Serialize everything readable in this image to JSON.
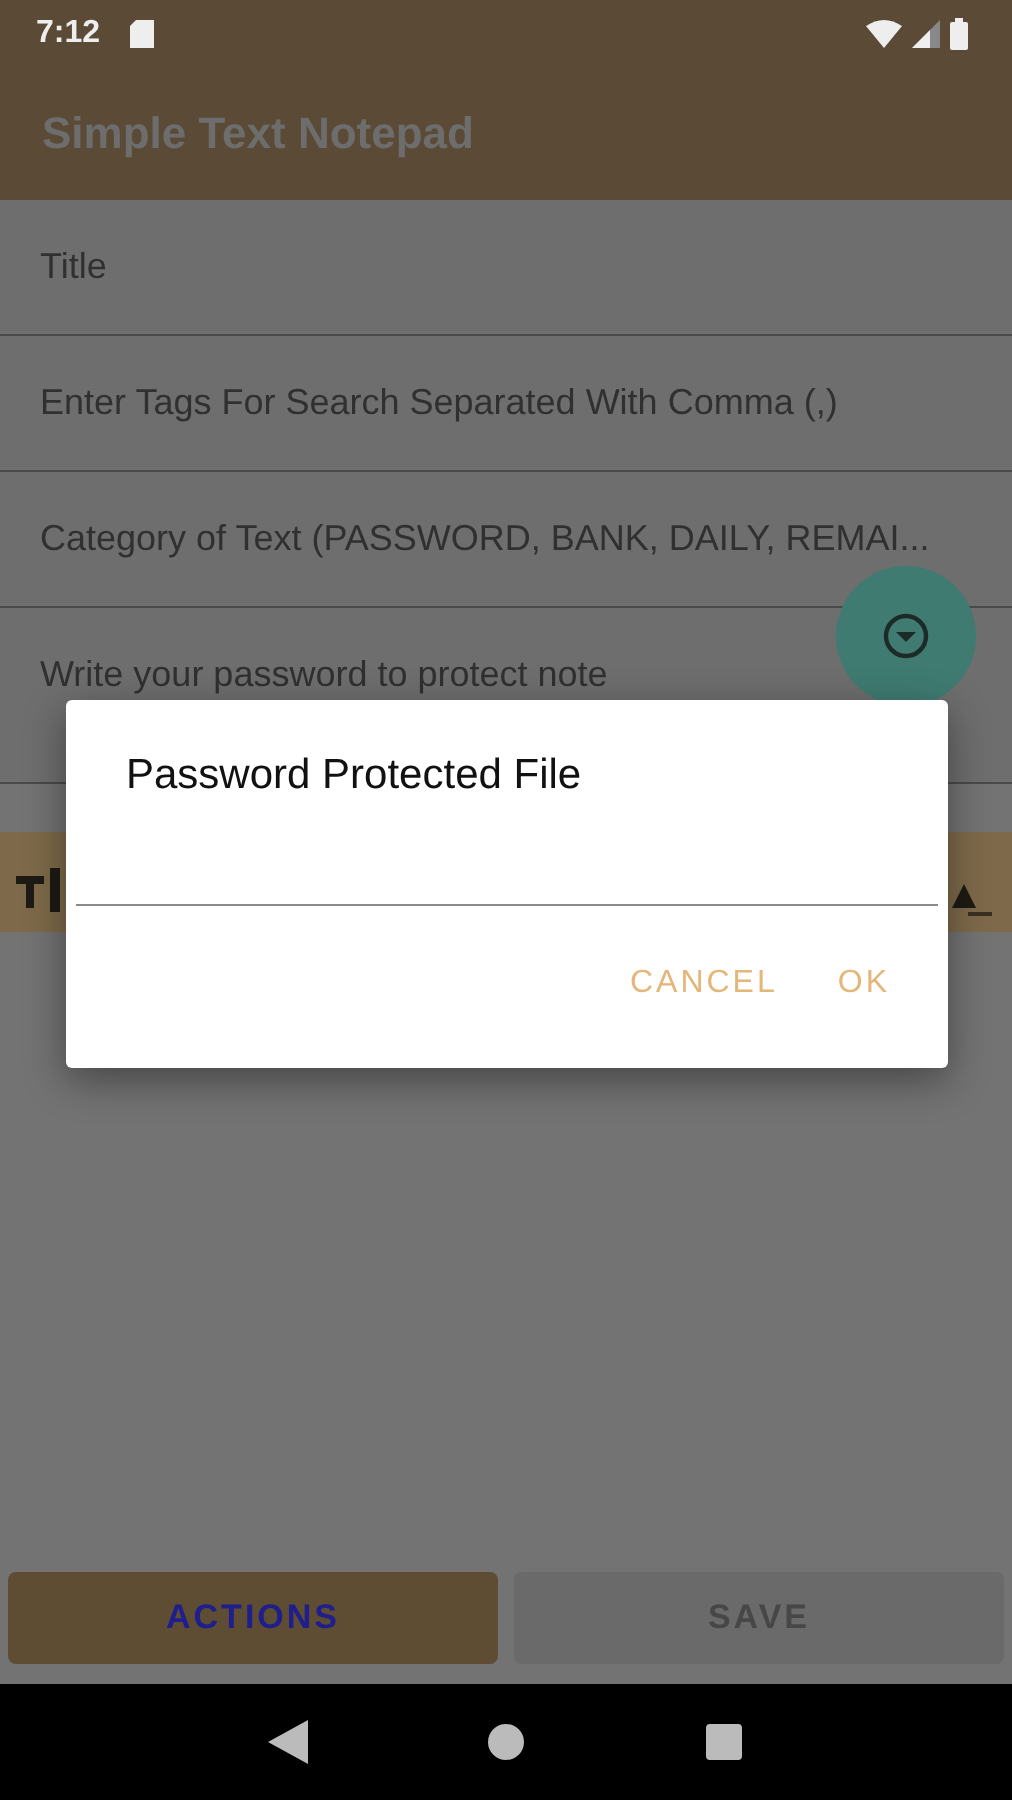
{
  "status_bar": {
    "time": "7:12"
  },
  "app_bar": {
    "title": "Simple Text Notepad"
  },
  "fields": [
    {
      "placeholder": "Title"
    },
    {
      "placeholder": "Enter Tags For Search Separated With Comma (,)"
    },
    {
      "placeholder": "Category of Text (PASSWORD, BANK, DAILY, REMAI..."
    },
    {
      "placeholder": "Write your password to protect note"
    }
  ],
  "dialog": {
    "title": "Password Protected File",
    "buttons": [
      "CANCEL",
      "OK"
    ]
  },
  "bottom_buttons": [
    {
      "label": "ACTIONS",
      "disabled": false
    },
    {
      "label": "SAVE",
      "disabled": true
    }
  ]
}
